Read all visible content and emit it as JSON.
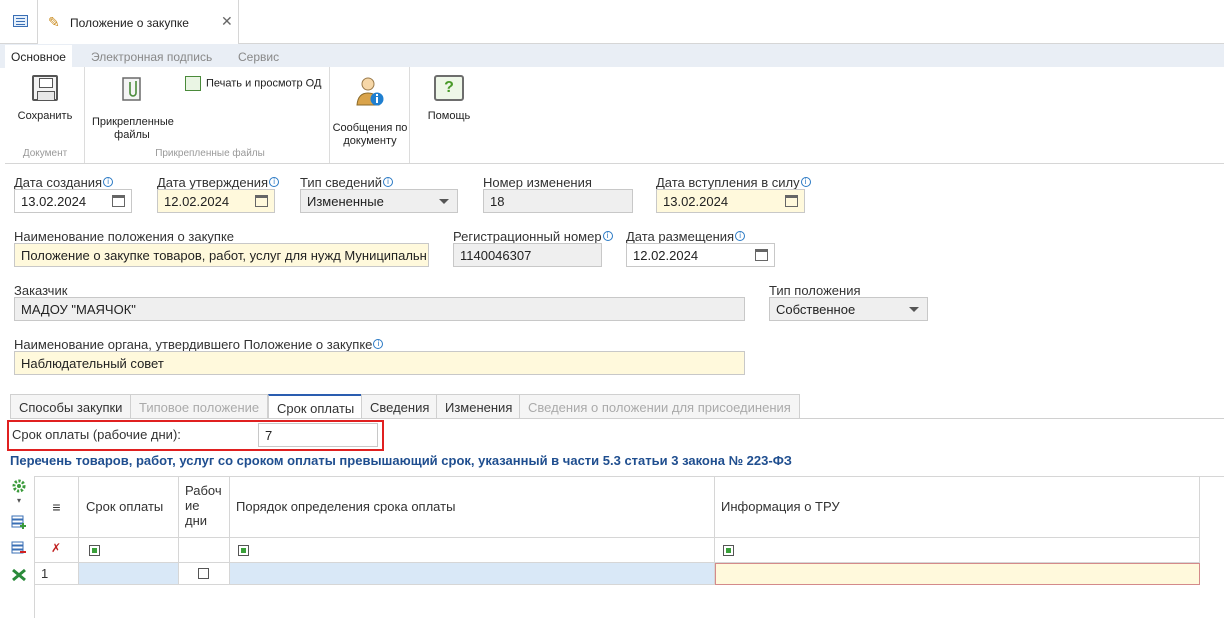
{
  "tab": {
    "title": "Положение о закупке"
  },
  "ribbon": {
    "tabs": [
      "Основное",
      "Электронная подпись",
      "Сервис"
    ],
    "save_label": "Сохранить",
    "group_document": "Документ",
    "attached_label_line1": "Прикрепленные",
    "attached_label_line2": "файлы",
    "print_label": "Печать и просмотр ОД",
    "group_attached": "Прикрепленные файлы",
    "messages_line1": "Сообщения по",
    "messages_line2": "документу",
    "help_label": "Помощь"
  },
  "form": {
    "created_label": "Дата создания",
    "created_value": "13.02.2024",
    "approved_label": "Дата утверждения",
    "approved_value": "12.02.2024",
    "info_type_label": "Тип сведений",
    "info_type_value": "Измененные",
    "change_no_label": "Номер изменения",
    "change_no_value": "18",
    "effective_label": "Дата вступления в силу",
    "effective_value": "13.02.2024",
    "name_label": "Наименование положения о закупке",
    "name_value": "Положение о закупке товаров, работ, услуг для нужд Муниципальн",
    "reg_no_label": "Регистрационный номер",
    "reg_no_value": "1140046307",
    "placement_label": "Дата размещения",
    "placement_value": "12.02.2024",
    "customer_label": "Заказчик",
    "customer_value": "МАДОУ \"МАЯЧОК\"",
    "pol_type_label": "Тип положения",
    "pol_type_value": "Собственное",
    "organ_label": "Наименование органа, утвердившего Положение о закупке",
    "organ_value": "Наблюдательный совет"
  },
  "detail_tabs": [
    "Способы закупки",
    "Типовое положение",
    "Срок оплаты",
    "Сведения",
    "Изменения",
    "Сведения о положении для присоединения"
  ],
  "payment": {
    "label": "Срок оплаты (рабочие дни):",
    "value": "7",
    "section_title": "Перечень товаров, работ, услуг со сроком оплаты превышающий срок, указанный в части 5.3 статьи 3 закона № 223-ФЗ"
  },
  "grid": {
    "headers": {
      "menu": "≡",
      "term": "Срок оплаты",
      "workdays_1": "Рабоч",
      "workdays_2": "ие",
      "workdays_3": "дни",
      "procedure": "Порядок определения срока оплаты",
      "tru": "Информация о ТРУ"
    },
    "rows": [
      {
        "num": "1"
      }
    ]
  }
}
